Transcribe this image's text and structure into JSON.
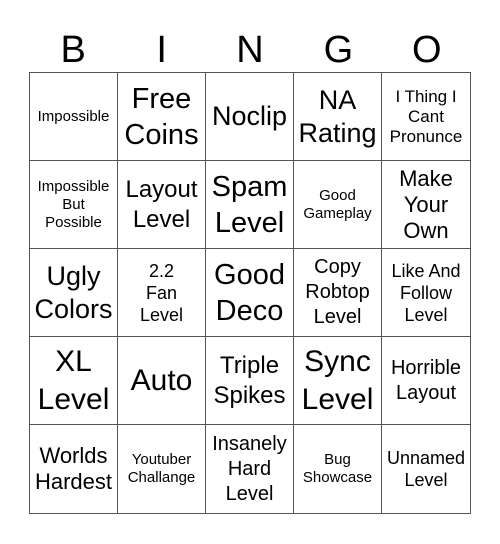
{
  "header": [
    "B",
    "I",
    "N",
    "G",
    "O"
  ],
  "cells": [
    [
      "Impossible"
    ],
    [
      "Free",
      "Coins"
    ],
    [
      "Noclip"
    ],
    [
      "NA",
      "Rating"
    ],
    [
      "I Thing I",
      "Cant",
      "Pronunce"
    ],
    [
      "Impossible",
      "But",
      "Possible"
    ],
    [
      "Layout",
      "Level"
    ],
    [
      "Spam",
      "Level"
    ],
    [
      "Good",
      "Gameplay"
    ],
    [
      "Make",
      "Your",
      "Own"
    ],
    [
      "Ugly",
      "Colors"
    ],
    [
      "2.2",
      "Fan",
      "Level"
    ],
    [
      "Good",
      "Deco"
    ],
    [
      "Copy",
      "Robtop",
      "Level"
    ],
    [
      "Like And",
      "Follow",
      "Level"
    ],
    [
      "XL",
      "Level"
    ],
    [
      "Auto"
    ],
    [
      "Triple",
      "Spikes"
    ],
    [
      "Sync",
      "Level"
    ],
    [
      "Horrible",
      "Layout"
    ],
    [
      "Worlds",
      "Hardest"
    ],
    [
      "Youtuber",
      "Challange"
    ],
    [
      "Insanely",
      "Hard",
      "Level"
    ],
    [
      "Bug",
      "Showcase"
    ],
    [
      "Unnamed",
      "Level"
    ]
  ]
}
